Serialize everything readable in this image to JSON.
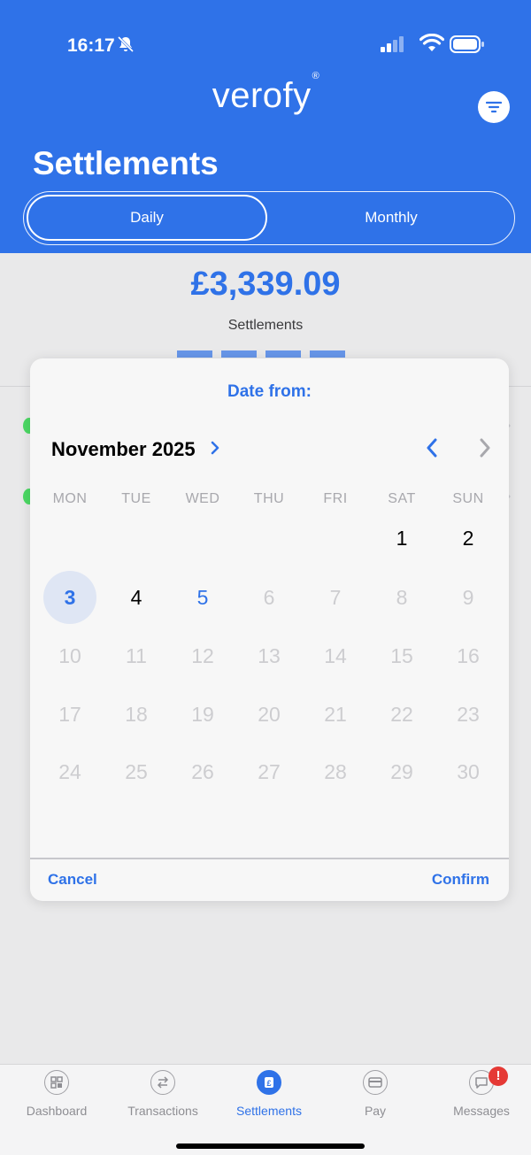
{
  "status_bar": {
    "time": "16:17"
  },
  "header": {
    "logo": "verofy",
    "logo_mark": "®",
    "title": "Settlements",
    "tabs": [
      {
        "label": "Daily",
        "selected": true
      },
      {
        "label": "Monthly",
        "selected": false
      }
    ]
  },
  "summary": {
    "amount": "£3,339.09",
    "label": "Settlements"
  },
  "date_picker": {
    "title": "Date from:",
    "month_label": "November 2025",
    "weekdays": [
      "MON",
      "TUE",
      "WED",
      "THU",
      "FRI",
      "SAT",
      "SUN"
    ],
    "selected_day": "3",
    "today": "5",
    "cancel_label": "Cancel",
    "confirm_label": "Confirm",
    "weeks": [
      [
        "",
        "",
        "",
        "",
        "",
        "1",
        "2"
      ],
      [
        "3",
        "4",
        "5",
        "6",
        "7",
        "8",
        "9"
      ],
      [
        "10",
        "11",
        "12",
        "13",
        "14",
        "15",
        "16"
      ],
      [
        "17",
        "18",
        "19",
        "20",
        "21",
        "22",
        "23"
      ],
      [
        "24",
        "25",
        "26",
        "27",
        "28",
        "29",
        "30"
      ]
    ],
    "last_enabled_day": 5
  },
  "tab_bar": {
    "items": [
      {
        "label": "Dashboard",
        "icon": "dashboard-icon"
      },
      {
        "label": "Transactions",
        "icon": "transactions-icon"
      },
      {
        "label": "Settlements",
        "icon": "settlements-icon",
        "active": true
      },
      {
        "label": "Pay",
        "icon": "pay-icon"
      },
      {
        "label": "Messages",
        "icon": "messages-icon",
        "badge": "!"
      }
    ]
  },
  "colors": {
    "brand_blue": "#2f72e8",
    "success_green": "#4cd964",
    "badge_red": "#e53935"
  }
}
